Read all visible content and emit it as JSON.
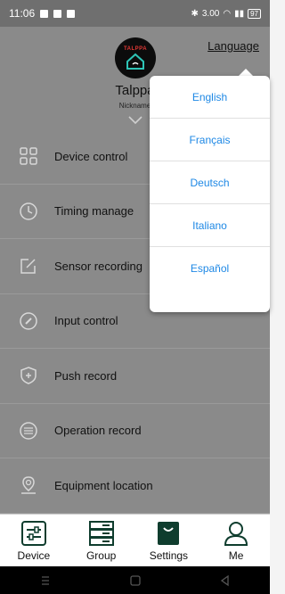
{
  "status_bar": {
    "time": "11:06",
    "net_speed": "3.00",
    "battery": "97"
  },
  "profile": {
    "logo_text": "TALPPA",
    "username": "Talppa",
    "nickname": "Nickname"
  },
  "language_link": "Language",
  "menu": [
    {
      "label": "Device control",
      "icon": "grid-icon"
    },
    {
      "label": "Timing manage",
      "icon": "clock-icon"
    },
    {
      "label": "Sensor recording",
      "icon": "edit-square-icon"
    },
    {
      "label": "Input control",
      "icon": "compass-icon"
    },
    {
      "label": "Push record",
      "icon": "shield-plus-icon"
    },
    {
      "label": "Operation record",
      "icon": "list-circle-icon"
    },
    {
      "label": "Equipment location",
      "icon": "location-pin-icon"
    }
  ],
  "languages": [
    "English",
    "Français",
    "Deutsch",
    "Italiano",
    "Español"
  ],
  "tabs": [
    {
      "label": "Device",
      "icon": "sliders-icon"
    },
    {
      "label": "Group",
      "icon": "server-stack-icon"
    },
    {
      "label": "Settings",
      "icon": "bag-icon",
      "active": true
    },
    {
      "label": "Me",
      "icon": "person-icon"
    }
  ],
  "colors": {
    "accent": "#1e88e5",
    "tab_green": "#0f3d2e",
    "dim_overlay": "#8a8a8a"
  }
}
